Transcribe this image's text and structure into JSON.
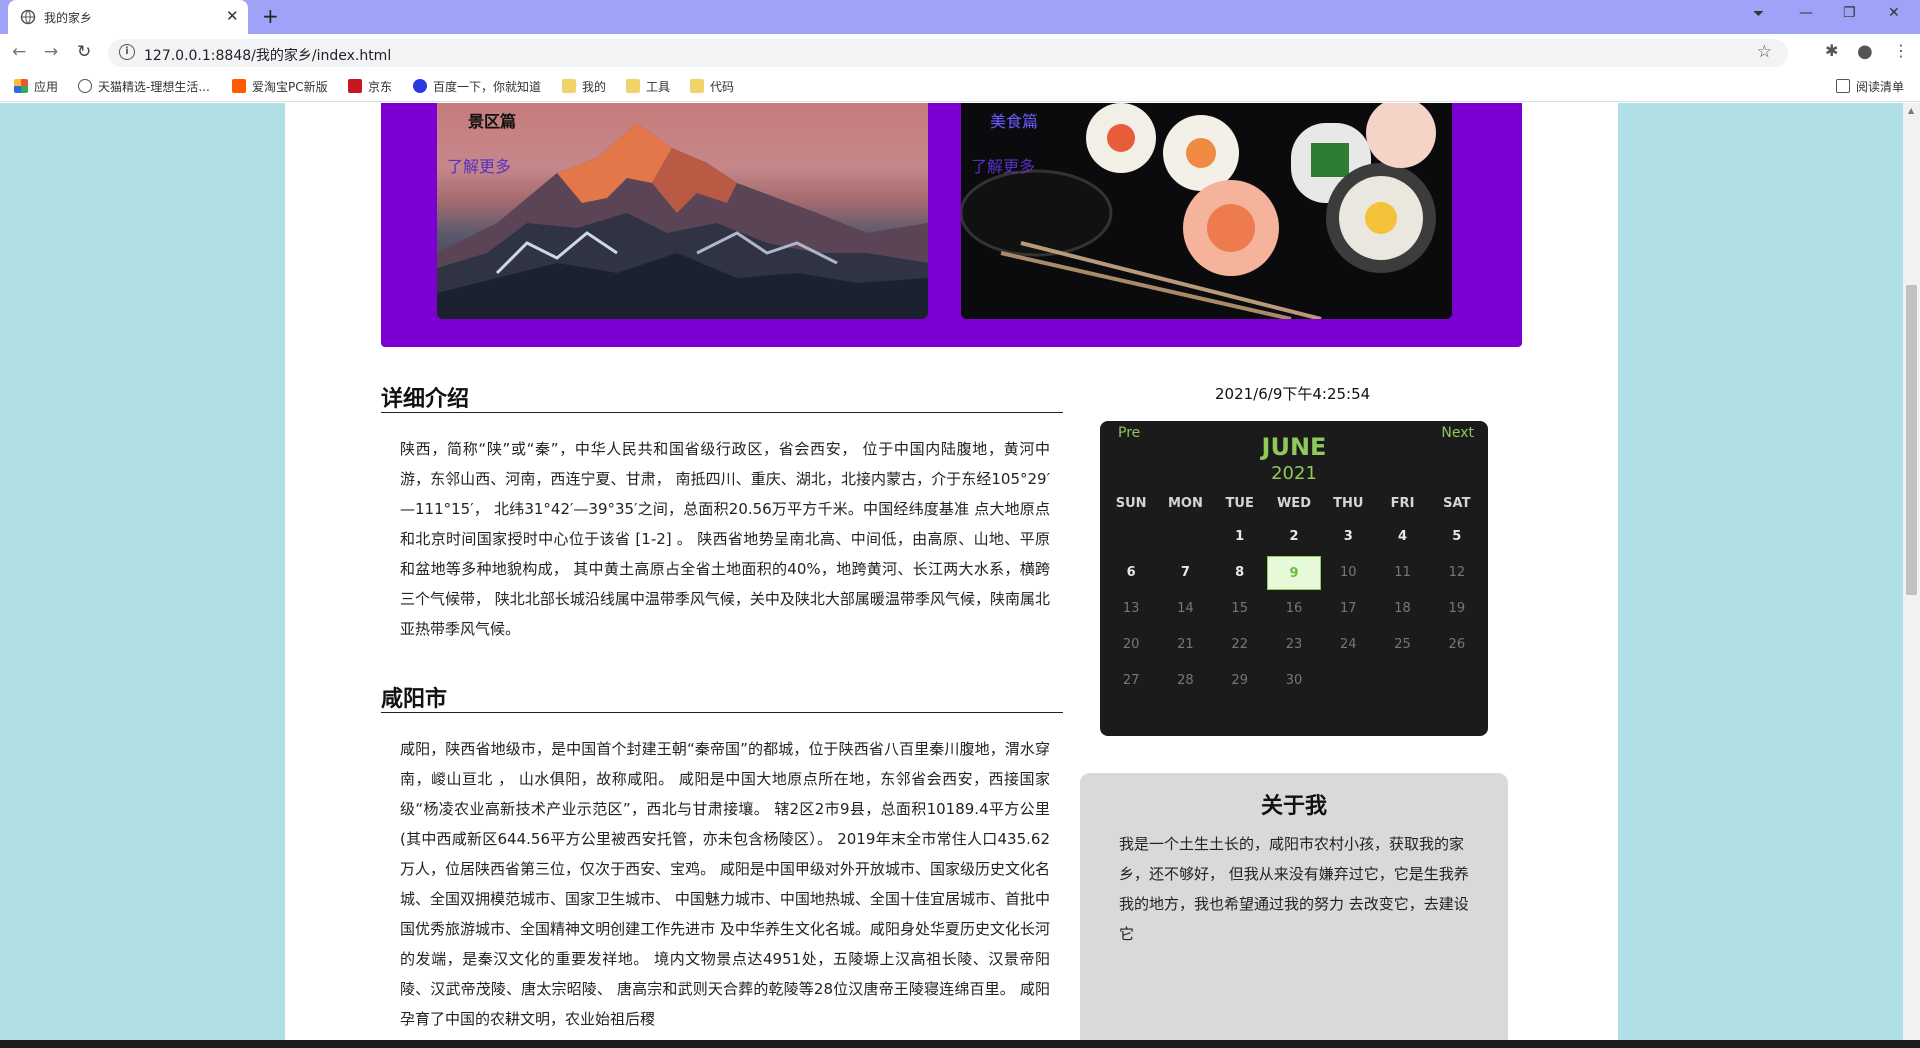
{
  "browser": {
    "tab_title": "我的家乡",
    "url": "127.0.0.1:8848/我的家乡/index.html",
    "bookmarks": [
      "应用",
      "天猫精选-理想生活...",
      "爱淘宝PC新版",
      "京东",
      "百度一下，你就知道",
      "我的",
      "工具",
      "代码"
    ],
    "reading_list": "阅读清单"
  },
  "banner": {
    "card1_title": "景区篇",
    "card1_link": "了解更多",
    "card2_title": "美食篇",
    "card2_link": "了解更多"
  },
  "intro": {
    "title": "详细介绍",
    "text": "陕西，简称“陕”或“秦”，中华人民共和国省级行政区，省会西安， 位于中国内陆腹地，黄河中游，东邻山西、河南，西连宁夏、甘肃， 南抵四川、重庆、湖北，北接内蒙古，介于东经105°29′—111°15′， 北纬31°42′—39°35′之间，总面积20.56万平方千米。中国经纬度基准 点大地原点和北京时间国家授时中心位于该省 [1-2] 。 陕西省地势呈南北高、中间低，由高原、山地、平原和盆地等多种地貌构成， 其中黄土高原占全省土地面积的40%，地跨黄河、长江两大水系，横跨三个气候带， 陕北北部长城沿线属中温带季风气候，关中及陕北大部属暖温带季风气候，陕南属北 亚热带季风气候。"
  },
  "city": {
    "title": "咸阳市",
    "text": "咸阳，陕西省地级市，是中国首个封建王朝“秦帝国”的都城，位于陕西省八百里秦川腹地，渭水穿南，嵕山亘北 ， 山水俱阳，故称咸阳。 咸阳是中国大地原点所在地，东邻省会西安，西接国家级“杨凌农业高新技术产业示范区”，西北与甘肃接壤。 辖2区2市9县，总面积10189.4平方公里(其中西咸新区644.56平方公里被西安托管，亦未包含杨陵区）。 2019年末全市常住人口435.62万人，位居陕西省第三位，仅次于西安、宝鸡。 咸阳是中国甲级对外开放城市、国家级历史文化名城、全国双拥模范城市、国家卫生城市、 中国魅力城市、中国地热城、全国十佳宜居城市、首批中国优秀旅游城市、全国精神文明创建工作先进市 及中华养生文化名城。咸阳身处华夏历史文化长河的发端，是秦汉文化的重要发祥地。 境内文物景点达4951处，五陵塬上汉高祖长陵、汉景帝阳陵、汉武帝茂陵、唐太宗昭陵、 唐高宗和武则天合葬的乾陵等28位汉唐帝王陵寝连绵百里。 咸阳孕育了中国的农耕文明，农业始祖后稷"
  },
  "clock": {
    "text": "2021/6/9下午4:25:54"
  },
  "calendar": {
    "pre": "Pre",
    "next": "Next",
    "month": "JUNE",
    "year": "2021",
    "weekdays": [
      "SUN",
      "MON",
      "TUE",
      "WED",
      "THU",
      "FRI",
      "SAT"
    ],
    "today": "9",
    "weeks": [
      [
        "",
        "",
        "1",
        "2",
        "3",
        "4",
        "5"
      ],
      [
        "6",
        "7",
        "8",
        "9",
        "10",
        "11",
        "12"
      ],
      [
        "13",
        "14",
        "15",
        "16",
        "17",
        "18",
        "19"
      ],
      [
        "20",
        "21",
        "22",
        "23",
        "24",
        "25",
        "26"
      ],
      [
        "27",
        "28",
        "29",
        "30",
        "",
        "",
        ""
      ]
    ],
    "accent_color": "#8ec95a"
  },
  "about": {
    "title": "关于我",
    "text": "我是一个土生土长的，咸阳市农村小孩，获取我的家乡，还不够好， 但我从来没有嫌弃过它，它是生我养我的地方，我也希望通过我的努力 去改变它，去建设它"
  },
  "colors": {
    "banner": "#7c00d2",
    "page_bg": "#b0dfe5"
  }
}
